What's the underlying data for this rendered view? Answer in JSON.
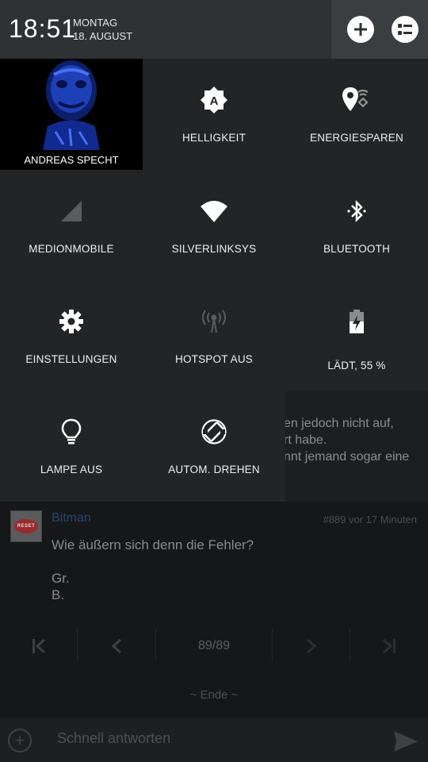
{
  "status": {
    "time": "18:51",
    "day": "MONTAG",
    "date": "18. AUGUST"
  },
  "user": {
    "name": "ANDREAS SPECHT"
  },
  "tiles": [
    {
      "label": "HELLIGKEIT",
      "icon": "brightness-auto-icon"
    },
    {
      "label": "ENERGIESPAREN",
      "icon": "location-energy-icon"
    },
    {
      "label": "MEDIONMOBILE",
      "icon": "cell-signal-icon"
    },
    {
      "label": "SILVERLINKSYS",
      "icon": "wifi-icon"
    },
    {
      "label": "BLUETOOTH",
      "icon": "bluetooth-icon"
    },
    {
      "label": "EINSTELLUNGEN",
      "icon": "gear-icon"
    },
    {
      "label": "HOTSPOT AUS",
      "icon": "hotspot-icon"
    },
    {
      "label": "LÄDT, 55 %",
      "icon": "battery-charging-icon",
      "level_percent": 55
    },
    {
      "label": "LAMPE AUS",
      "icon": "lightbulb-icon"
    },
    {
      "label": "AUTOM. DREHEN",
      "icon": "rotate-icon"
    }
  ],
  "post_fragment": [
    "en jedoch nicht auf,",
    "rt habe.",
    "nnt jemand sogar eine"
  ],
  "post": {
    "author": "Bitman",
    "meta": "#889  vor 17 Minuten",
    "avatar_text": "RESET",
    "body": [
      "Wie äußern sich denn die Fehler?",
      "Gr.",
      "B."
    ]
  },
  "pager": {
    "page": "89/89"
  },
  "end_label": "~ Ende ~",
  "reply": {
    "placeholder": "Schnell antworten"
  },
  "colors": {
    "panel": "#222426",
    "header": "#2e3235",
    "accent_link": "#24486e"
  }
}
